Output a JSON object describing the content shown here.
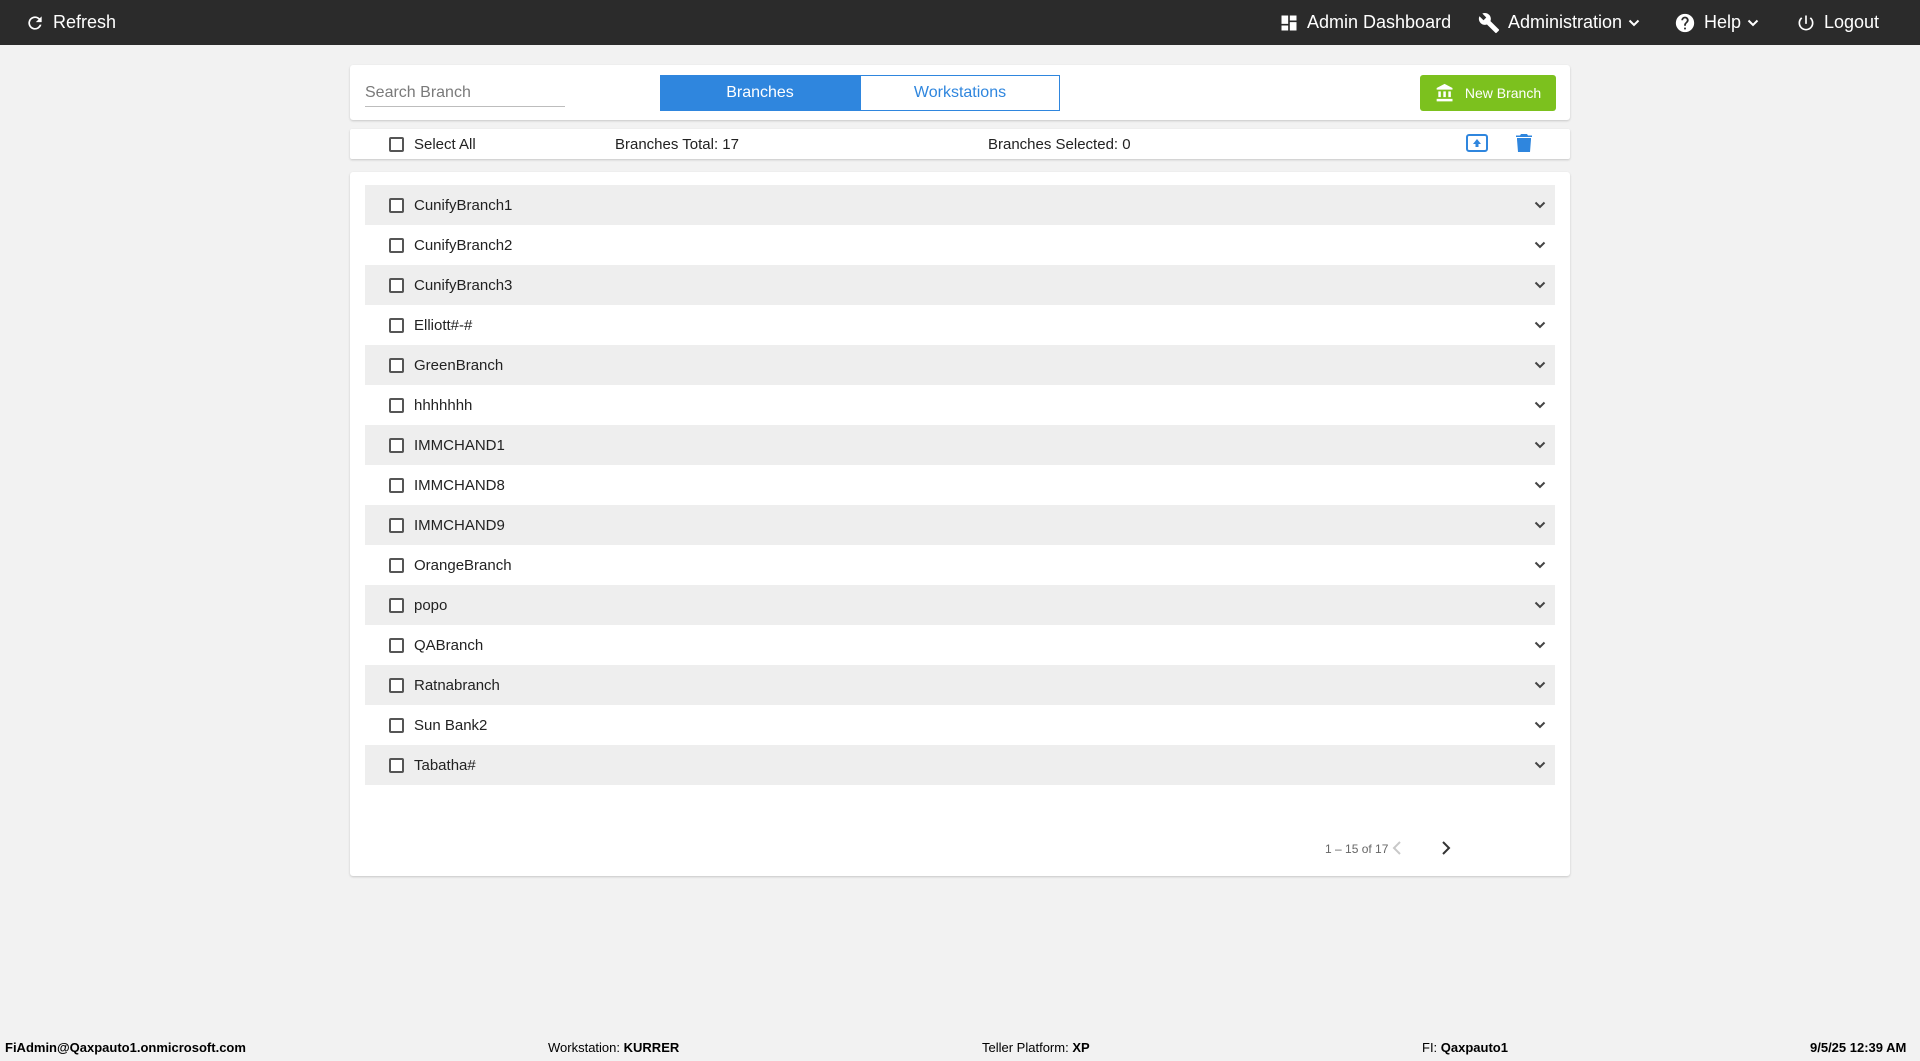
{
  "header": {
    "refresh_label": "Refresh",
    "admin_dashboard_label": "Admin Dashboard",
    "administration_label": "Administration",
    "help_label": "Help",
    "logout_label": "Logout"
  },
  "toolbar": {
    "search_placeholder": "Search Branch",
    "tabs": [
      {
        "label": "Branches",
        "active": true
      },
      {
        "label": "Workstations",
        "active": false
      }
    ],
    "new_branch_label": "New Branch"
  },
  "selection_bar": {
    "select_all_label": "Select All",
    "total_text": "Branches Total: 17",
    "selected_text": "Branches Selected: 0",
    "icons": [
      "upload-icon",
      "trash-icon"
    ]
  },
  "branches": [
    "CunifyBranch1",
    "CunifyBranch2",
    "CunifyBranch3",
    "Elliott#-#",
    "GreenBranch",
    "hhhhhhh",
    "IMMCHAND1",
    "IMMCHAND8",
    "IMMCHAND9",
    "OrangeBranch",
    "popo",
    "QABranch",
    "Ratnabranch",
    "Sun Bank2",
    "Tabatha#"
  ],
  "pagination": {
    "range_text": "1 – 15 of 17"
  },
  "footer": {
    "user": "FiAdmin@Qaxpauto1.onmicrosoft.com",
    "workstation_label": "Workstation:",
    "workstation_value": "KURRER",
    "platform_label": "Teller Platform:",
    "platform_value": "XP",
    "fi_label": "FI:",
    "fi_value": "Qaxpauto1",
    "datetime": "9/5/25 12:39 AM"
  },
  "colors": {
    "accent": "#2f86de",
    "new_button": "#7cc11e",
    "topbar": "#2b2b2b"
  }
}
